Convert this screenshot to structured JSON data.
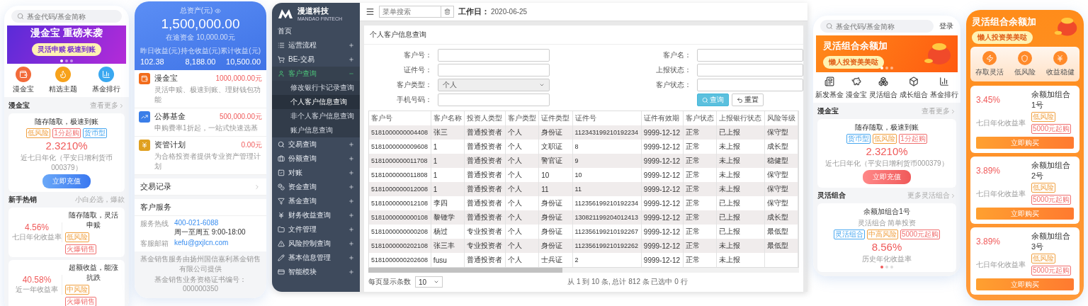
{
  "phone_home": {
    "search": {
      "placeholder": "基金代码/基金简称"
    },
    "banner": {
      "title": "漫金宝 重磅来袭",
      "subtitle": "灵活申赎  极速到账",
      "dots": [
        {
          "selected": true
        },
        {
          "selected": false
        },
        {
          "selected": false
        }
      ]
    },
    "shortcuts": [
      {
        "label": "漫金宝",
        "color": "#f26b3a"
      },
      {
        "label": "精选主题",
        "color": "#f7a21b"
      },
      {
        "label": "基金排行",
        "color": "#3aa8f0"
      }
    ],
    "featured_section": {
      "title": "漫金宝",
      "link": "查看更多"
    },
    "featured_card": {
      "headline": "随存随取，极速到账",
      "tags": [
        {
          "label": "低风险",
          "color": "#f0a040"
        },
        {
          "label": "1分起购",
          "color": "#f07070"
        },
        {
          "label": "货币型",
          "color": "#4aa8f0"
        }
      ],
      "rate": "2.3210%",
      "rate_note": "近七日年化（平安日增利货币000379）",
      "button": "立即充值"
    },
    "hot_section": {
      "title": "新手热销",
      "aside": "小白必选，爆款"
    },
    "products": [
      {
        "rate": "4.56%",
        "rate_label": "七日年化收益率",
        "title": "随存随取，灵活申赎",
        "tags": [
          {
            "label": "低风险",
            "color": "#f0a040"
          },
          {
            "label": "火爆销售",
            "color": "#f07070"
          }
        ]
      },
      {
        "rate": "40.58%",
        "rate_label": "近一年收益率",
        "title": "超额收益，能涨抗跌",
        "tags": [
          {
            "label": "中风险",
            "color": "#f0a040"
          },
          {
            "label": "火爆销售",
            "color": "#f07070"
          }
        ]
      }
    ]
  },
  "phone_assets": {
    "total_label": "总资产(元)",
    "total": "1,500,000.00",
    "in_transit": "在途资金 10,000.00元",
    "stats": [
      {
        "label": "昨日收益(元)",
        "value": "102.38"
      },
      {
        "label": "持仓收益(元)",
        "value": "8,188.00"
      },
      {
        "label": "累计收益(元)",
        "value": "10,500.00"
      }
    ],
    "holdings": [
      {
        "name": "漫金宝",
        "amount": "1000,000.00元",
        "description": "灵活申赎、极速到账、理财钱包功能",
        "color": "#f26b1a"
      },
      {
        "name": "公募基金",
        "amount": "500,000.00元",
        "description": "申购费率1折起，一站式快速选基",
        "color": "#3a7ee8"
      },
      {
        "name": "资管计划",
        "amount": "0.00元",
        "description": "为合格投资者提供专业资产管理计划",
        "color": "#e0a020"
      }
    ],
    "trade_record": "交易记录",
    "service": {
      "title": "客户服务",
      "rows": [
        {
          "label": "服务热线",
          "lines": [
            "400-021-6088",
            "周一至周五 9:00-18:00"
          ]
        },
        {
          "label": "客服邮箱",
          "lines": [
            "kefu@gxjlcn.com"
          ]
        }
      ]
    },
    "footer": [
      "基金销售服务由扬州国信嘉利基金销售有限公司提供",
      "基金销售业务资格证书编号：000000350"
    ]
  },
  "admin": {
    "logo": {
      "name": "漫道科技",
      "tagline": "MANDAO FINTECH"
    },
    "sidebar": [
      {
        "label": "首页",
        "kind": "link"
      },
      {
        "label": "运营流程",
        "kind": "group",
        "expanded": false
      },
      {
        "label": "BE-交易",
        "kind": "group",
        "expanded": false
      },
      {
        "label": "客户查询",
        "kind": "group",
        "expanded": true,
        "children": [
          {
            "label": "修改银行卡记录查询",
            "selected": false
          },
          {
            "label": "个人客户信息查询",
            "selected": true
          },
          {
            "label": "非个人客户信息查询",
            "selected": false
          },
          {
            "label": "账户信息查询",
            "selected": false
          }
        ]
      },
      {
        "label": "交易查询",
        "kind": "group",
        "expanded": false
      },
      {
        "label": "份额查询",
        "kind": "group",
        "expanded": false
      },
      {
        "label": "对账",
        "kind": "group",
        "expanded": false
      },
      {
        "label": "资金查询",
        "kind": "group",
        "expanded": false
      },
      {
        "label": "基金查询",
        "kind": "group",
        "expanded": false
      },
      {
        "label": "财务收益查询",
        "kind": "group",
        "expanded": false
      },
      {
        "label": "文件管理",
        "kind": "group",
        "expanded": false
      },
      {
        "label": "风险控制查询",
        "kind": "group",
        "expanded": false
      },
      {
        "label": "基本信息管理",
        "kind": "group",
        "expanded": false
      },
      {
        "label": "智能模块",
        "kind": "group",
        "expanded": false
      }
    ],
    "topbar": {
      "search_placeholder": "菜单搜索",
      "workday_label": "工作日：",
      "workday": "2020-06-25"
    },
    "panel_title": "个人客户信息查询",
    "form": {
      "left": [
        {
          "label": "客户号：",
          "kind": "input",
          "disabled": false
        },
        {
          "label": "证件号：",
          "kind": "input",
          "disabled": false
        },
        {
          "label": "客户类型：",
          "kind": "select",
          "value": "个人",
          "disabled": true
        },
        {
          "label": "手机号码：",
          "kind": "input",
          "disabled": false
        }
      ],
      "right": [
        {
          "label": "客户名：",
          "kind": "input",
          "disabled": false
        },
        {
          "label": "上报状态：",
          "kind": "input",
          "disabled": false
        },
        {
          "label": "客户状态：",
          "kind": "input",
          "disabled": false
        }
      ],
      "buttons": [
        {
          "label": "查询",
          "kind": "primary"
        },
        {
          "label": "重置",
          "kind": "reset"
        }
      ]
    },
    "table": {
      "columns": [
        "客户号",
        "客户名称",
        "投资人类型",
        "客户类型",
        "证件类型",
        "证件号",
        "证件有效期",
        "客户状态",
        "上报银行状态",
        "风险等级"
      ],
      "rows": [
        [
          "5181000000004408",
          "张三",
          "普通投资者",
          "个人",
          "身份证",
          "112343199210192234",
          "9999-12-12",
          "正常",
          "已上报",
          "保守型"
        ],
        [
          "5181000000009608",
          "1",
          "普通投资者",
          "个人",
          "文职证",
          "8",
          "9999-12-12",
          "正常",
          "未上报",
          "成长型"
        ],
        [
          "5181000000011708",
          "1",
          "普通投资者",
          "个人",
          "警官证",
          "9",
          "9999-12-12",
          "正常",
          "未上报",
          "稳健型"
        ],
        [
          "5181000000011808",
          "1",
          "普通投资者",
          "个人",
          "10",
          "10",
          "9999-12-12",
          "正常",
          "未上报",
          "保守型"
        ],
        [
          "5181000000012008",
          "1",
          "普通投资者",
          "个人",
          "11",
          "11",
          "9999-12-12",
          "正常",
          "未上报",
          "保守型"
        ],
        [
          "5181000000012108",
          "李四",
          "普通投资者",
          "个人",
          "身份证",
          "112356199210192234",
          "9999-12-12",
          "正常",
          "已上报",
          "保守型"
        ],
        [
          "5181000000000108",
          "黎锺学",
          "普通投资者",
          "个人",
          "身份证",
          "130821199204012413",
          "9999-12-12",
          "正常",
          "已上报",
          "成长型"
        ],
        [
          "5181000000000208",
          "杨过",
          "专业投资者",
          "个人",
          "身份证",
          "112356199210192267",
          "9999-12-12",
          "正常",
          "已上报",
          "最低型"
        ],
        [
          "5181000000202108",
          "张三丰",
          "专业投资者",
          "个人",
          "身份证",
          "112356199210192262",
          "9999-12-12",
          "正常",
          "未上报",
          "最低型"
        ],
        [
          "5181000000202608",
          "fusu",
          "普通投资者",
          "个人",
          "士兵证",
          "2",
          "9999-12-12",
          "正常",
          "未上报"
        ]
      ]
    },
    "pagination": {
      "page_size_label": "每页显示条数",
      "page_size": "10",
      "summary": "从 1 到 10 条, 总计 812 条 已选中 0 行"
    }
  },
  "phone_market": {
    "search": {
      "placeholder": "基金代码/基金简称"
    },
    "login": "登录",
    "banner": {
      "title": "灵活组合余额加",
      "subtitle": "懒人投资美美哒",
      "dots": [
        {
          "selected": true
        },
        {
          "selected": false
        },
        {
          "selected": false
        }
      ]
    },
    "shortcuts": [
      "新发基金",
      "漫金宝",
      "灵活组合",
      "成长组合",
      "基金排行"
    ],
    "featured_section": {
      "title": "漫金宝",
      "link": "查看更多"
    },
    "featured_card": {
      "headline": "随存随取，极速到账",
      "tags": [
        {
          "label": "货币型",
          "color": "#4aa8f0"
        },
        {
          "label": "低风险",
          "color": "#f0a040"
        },
        {
          "label": "1分起购",
          "color": "#f07070"
        }
      ],
      "rate": "2.3210%",
      "rate_note": "近七日年化（平安日增利货币000379）",
      "button": "立即充值"
    },
    "combo_section": {
      "title": "灵活组合",
      "link": "更多灵活组合"
    },
    "combo_card": {
      "name": "余额加组合1号",
      "subtitle": "灵活组合 简单投资",
      "tags": [
        {
          "label": "灵活组合",
          "color": "#4aa8f0"
        },
        {
          "label": "中高风险",
          "color": "#f0a040"
        },
        {
          "label": "5000元起购",
          "color": "#f07070"
        }
      ],
      "rate": "8.56%",
      "rate_label": "历史年化收益率",
      "dots": [
        {
          "selected": true
        },
        {
          "selected": false
        },
        {
          "selected": false
        }
      ]
    }
  },
  "phone_combo": {
    "banner": {
      "title": "灵活组合余额加",
      "subtitle": "懒人投资美美哒"
    },
    "features": [
      "存取灵活",
      "低风险",
      "收益稳健"
    ],
    "products": [
      {
        "rate": "3.45%",
        "rate_label": "七日年化收益率",
        "name": "余额加组合1号",
        "tags": [
          {
            "label": "低风险",
            "color": "#f0a040"
          },
          {
            "label": "5000元起购",
            "color": "#f07070"
          }
        ],
        "button": "立即购买"
      },
      {
        "rate": "3.89%",
        "rate_label": "七日年化收益率",
        "name": "余额加组合2号",
        "tags": [
          {
            "label": "低风险",
            "color": "#f0a040"
          },
          {
            "label": "5000元起购",
            "color": "#f07070"
          }
        ],
        "button": "立即购买"
      },
      {
        "rate": "3.89%",
        "rate_label": "七日年化收益率",
        "name": "余额加组合3号",
        "tags": [
          {
            "label": "低风险",
            "color": "#f0a040"
          },
          {
            "label": "5000元起购",
            "color": "#f07070"
          }
        ],
        "button": "立即购买"
      }
    ]
  }
}
